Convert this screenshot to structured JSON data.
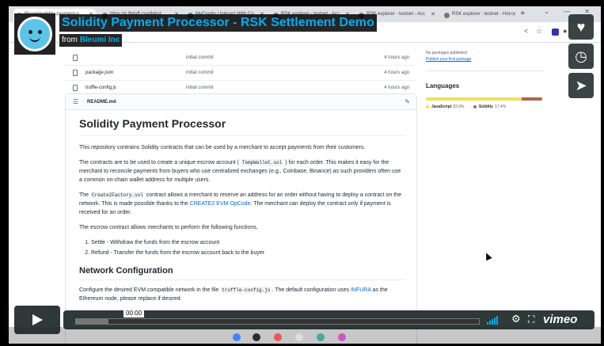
{
  "browser": {
    "tabs": [
      {
        "label": "Bleumi/solidity-payment-p",
        "active": true
      },
      {
        "label": "https://g.fbdvff.csydbdcd",
        "active": false
      },
      {
        "label": "MyCrypto | Interact With Co",
        "active": false
      },
      {
        "label": "RSK explorer - testnet - Acc",
        "active": false
      },
      {
        "label": "RSK explorer - testnet - Acc",
        "active": false
      },
      {
        "label": "RSK explorer : testnet - Hon",
        "active": false
      }
    ],
    "new_tab": "+",
    "window_controls": "⌄ — ✕"
  },
  "files": [
    {
      "name": "",
      "message": "initial commit",
      "age": "4 hours ago"
    },
    {
      "name": "package.json",
      "message": "initial commit",
      "age": "4 hours ago"
    },
    {
      "name": "truffle-config.js",
      "message": "initial commit",
      "age": "4 hours ago"
    }
  ],
  "readme": {
    "filename": "README.md",
    "title": "Solidity Payment Processor",
    "intro": "This repository contrains Solidity contracts that can be used by a merchant to accept payments from their customers.",
    "p2_a": "The contracts are to be used to create a unique escrow account (",
    "p2_code": "TempWallet.sol",
    "p2_b": ") for each order. This makes it easy for the merchant to reconcile payments from buyers who use centralized exchanges (e.g., Coinbase, Binance) as such providers often use a common on-chain wallet address for multiple users.",
    "p3_a": "The",
    "p3_code": "Create2Factory.sol",
    "p3_b": "contract allows a merchant to reserve an address for an order without having to deploy a contract on the network. This is made possible thanks to the",
    "p3_link": "CREATE2 EVM OpCode",
    "p3_c": ". The merchant can deploy the contract only if payment is received for an order.",
    "p4": "The escrow contract allows merchants to perform the following functions,",
    "functions": [
      "Settle - Withdraw the funds from the escrow account",
      "Refund - Transfer the funds from the escrow account back to the buyer"
    ],
    "h2": "Network Configuration",
    "p5_a": "Configure the desired EVM compatible network in the file",
    "p5_code": "truffle-config.js",
    "p5_b": ". The default configuration uses",
    "p5_link": "INFURA",
    "p5_c": "as the Ethereum node, please replace if desired."
  },
  "sidebar": {
    "packages_none": "No packages published",
    "packages_link": "Publish your first package",
    "languages_title": "Languages",
    "languages": [
      {
        "name": "JavaScript",
        "pct": "82.6%",
        "value": 82.6,
        "color": "#f1e05a"
      },
      {
        "name": "Solidity",
        "pct": "17.4%",
        "value": 17.4,
        "color": "#aa6746"
      }
    ]
  },
  "video": {
    "title": "Solidity Payment Processor - RSK Settlement Demo",
    "from_label": "from",
    "owner": "Bleumi Inc",
    "time": "00:00",
    "progress": 0.08,
    "brand": "vimeo",
    "accent": "#00adef"
  }
}
